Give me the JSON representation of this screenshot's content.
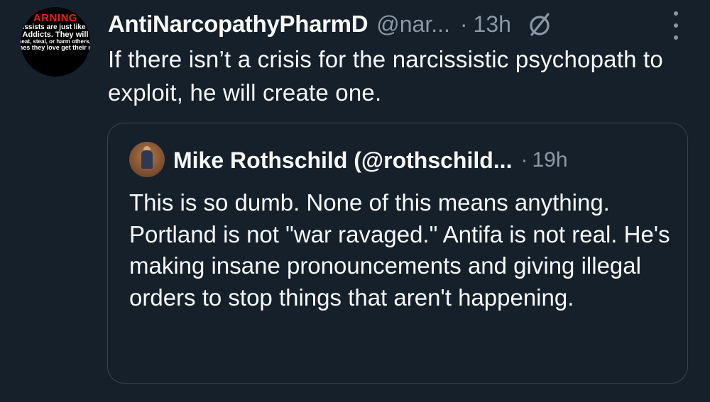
{
  "tweet": {
    "author_name": "AntiNarcopathyPharmD",
    "handle": "@nar...",
    "separator": "·",
    "time": "13h",
    "text": "If there isn’t a crisis for the narcissistic psychopath to exploit, he will create one.",
    "avatar": {
      "heading": "ARNING",
      "line1": "Narcissists are just like Drug",
      "line2": "Addicts. They will",
      "line3": "lie, cheat, steal, or harm others, even",
      "line4": "the ones they love get their next fi"
    },
    "icons": {
      "grok": "grok-slash-icon",
      "more": "more-vertical-icon"
    }
  },
  "quoted": {
    "author_name": "Mike Rothschild (@rothschild...",
    "separator": "·",
    "time": "19h",
    "text": "This is so dumb. None of this means anything. Portland is not \"war ravaged.\" Antifa is not real. He's making insane pronouncements and giving illegal orders to stop things that aren't happening."
  },
  "colors": {
    "background": "#15202b",
    "text": "#f7f9f9",
    "secondary": "#8b98a5",
    "border": "#38444d",
    "warning_red": "#e0261b"
  }
}
